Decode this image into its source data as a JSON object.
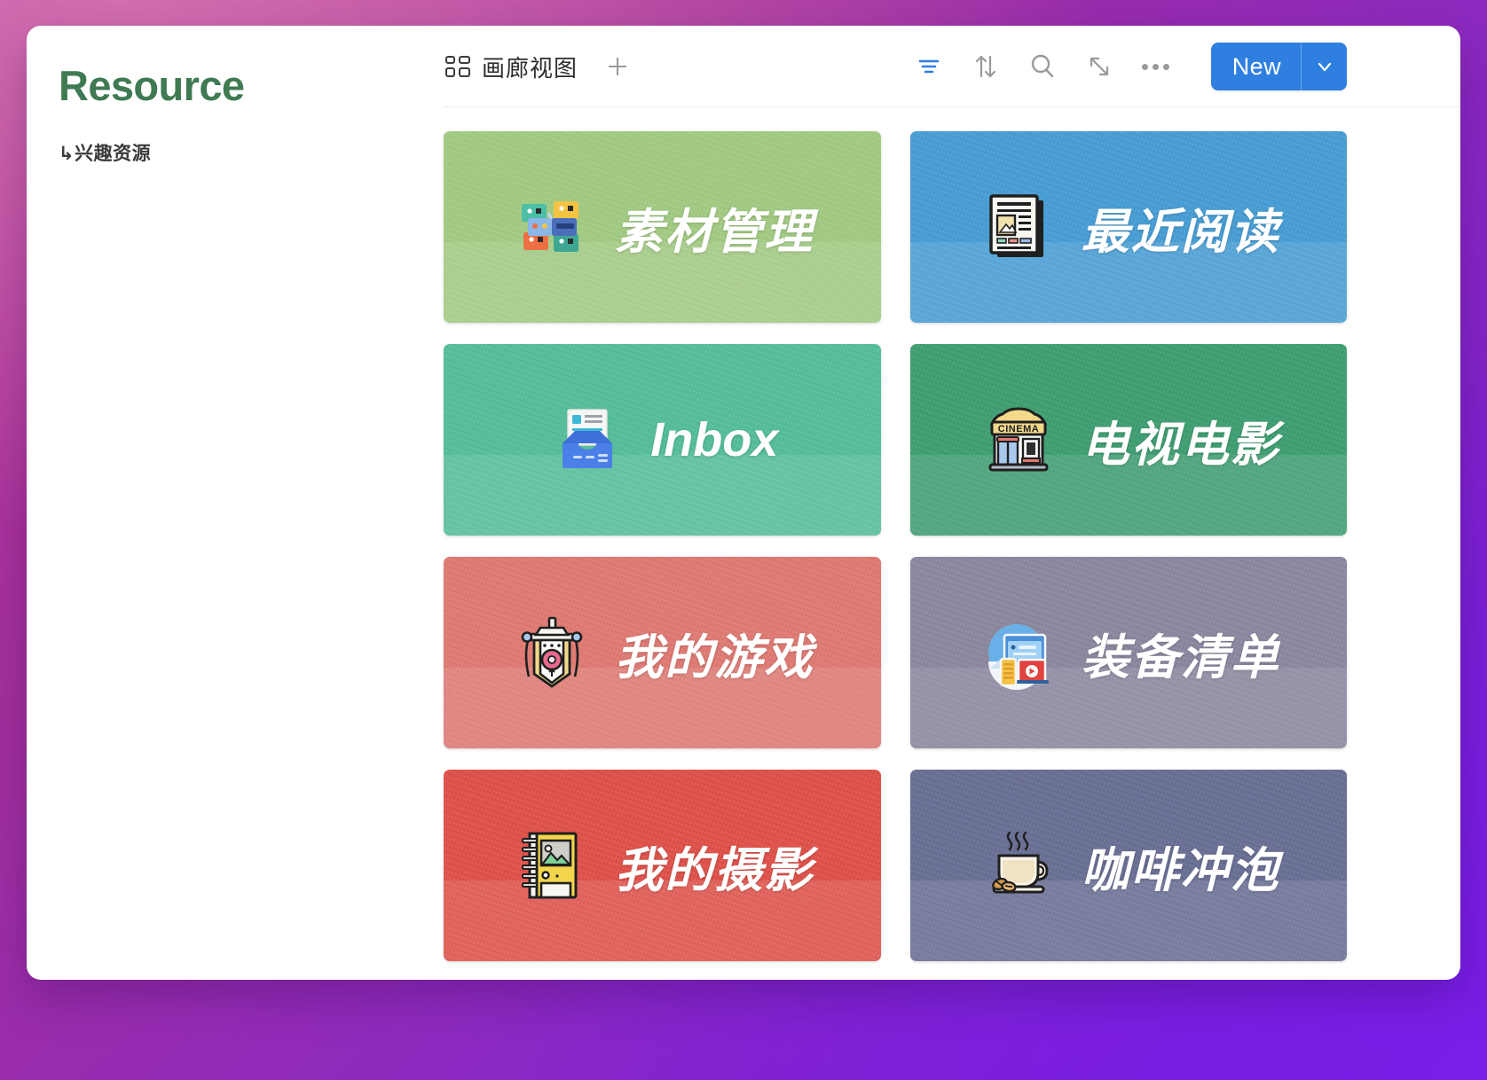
{
  "page": {
    "title": "Resource",
    "title_color": "#3f7a52",
    "breadcrumb": "↳兴趣资源"
  },
  "toolbar": {
    "view_tab_label": "画廊视图",
    "view_tab_icon": "gallery-grid-icon",
    "add_view_icon": "plus-icon",
    "actions": [
      {
        "name": "filter-icon",
        "label": "筛选",
        "color": "#2f7fe0"
      },
      {
        "name": "sort-icon",
        "label": "排序",
        "color": "#9a9a9a"
      },
      {
        "name": "search-icon",
        "label": "搜索",
        "color": "#9a9a9a"
      },
      {
        "name": "expand-icon",
        "label": "展开",
        "color": "#9a9a9a"
      },
      {
        "name": "more-icon",
        "label": "更多",
        "color": "#9a9a9a"
      }
    ],
    "new_label": "New",
    "new_caret_icon": "chevron-down-icon",
    "new_color": "#2f7fe0"
  },
  "gallery": {
    "cards": [
      {
        "title": "素材管理",
        "color": "#a3cc83",
        "icon": "material-blocks-icon",
        "latin": false
      },
      {
        "title": "最近阅读",
        "color": "#479ed6",
        "icon": "newspaper-icon",
        "latin": false
      },
      {
        "title": "Inbox",
        "color": "#55bf9b",
        "icon": "inbox-tray-icon",
        "latin": true
      },
      {
        "title": "电视电影",
        "color": "#3f9f72",
        "icon": "cinema-icon",
        "latin": false
      },
      {
        "title": "我的游戏",
        "color": "#e07a73",
        "icon": "game-banner-icon",
        "latin": false
      },
      {
        "title": "装备清单",
        "color": "#8b87a0",
        "icon": "devices-icon",
        "latin": false
      },
      {
        "title": "我的摄影",
        "color": "#e0514a",
        "icon": "photo-album-icon",
        "latin": false
      },
      {
        "title": "咖啡冲泡",
        "color": "#696f95",
        "icon": "coffee-cup-icon",
        "latin": false
      }
    ]
  }
}
